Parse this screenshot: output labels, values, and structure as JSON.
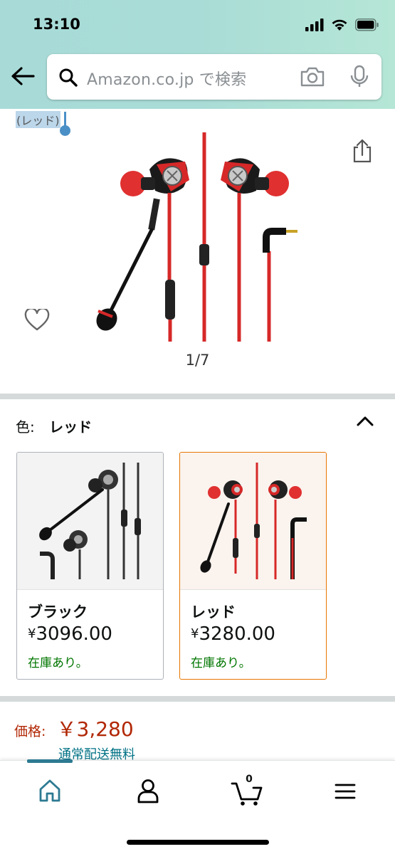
{
  "status_bar": {
    "time": "13:10"
  },
  "search": {
    "placeholder": "Amazon.co.jp で検索"
  },
  "selection_text": "(レッド)",
  "gallery": {
    "indicator": "1/7"
  },
  "color_selector": {
    "label": "色:",
    "selected": "レッド",
    "options": [
      {
        "name": "ブラック",
        "price_symbol": "¥",
        "price": "3096.00",
        "stock": "在庫あり。"
      },
      {
        "name": "レッド",
        "price_symbol": "¥",
        "price": "3280.00",
        "stock": "在庫あり。"
      }
    ]
  },
  "price": {
    "label": "価格:",
    "value": "￥3,280"
  },
  "shipping": "通常配送無料",
  "bottom_nav": {
    "cart_count": "0"
  },
  "colors": {
    "accent": "#2d7a92",
    "price": "#b12704",
    "stock": "#007600",
    "selected_border": "#e77600"
  }
}
